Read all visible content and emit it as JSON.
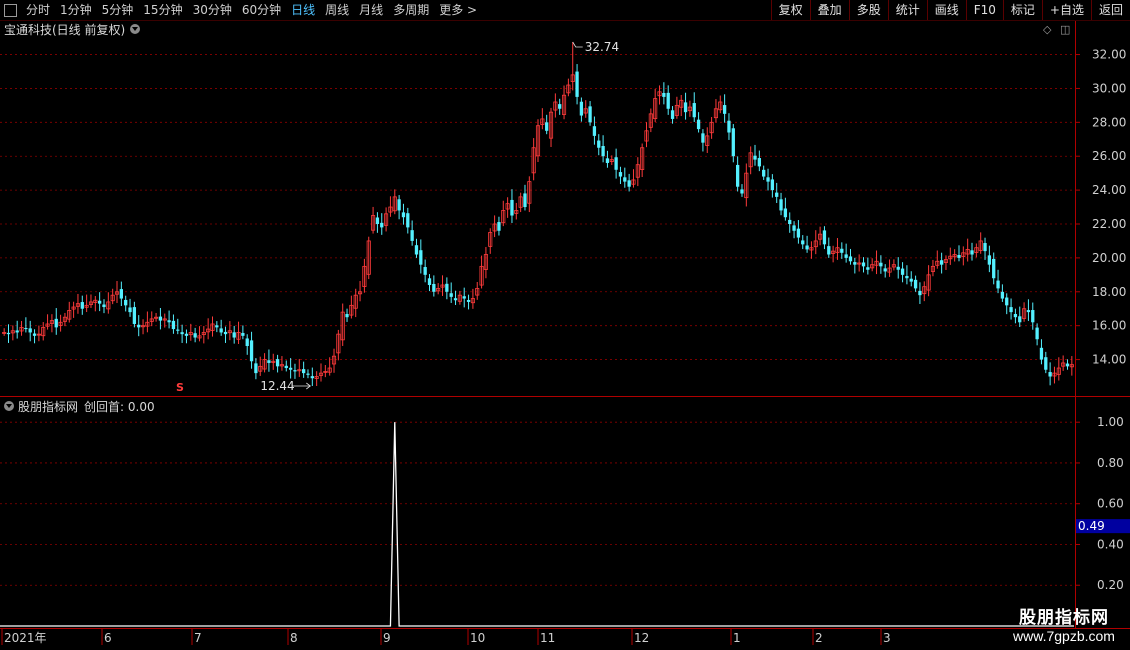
{
  "toolbar": {
    "periods": [
      "分时",
      "1分钟",
      "5分钟",
      "15分钟",
      "30分钟",
      "60分钟",
      "日线",
      "周线",
      "月线",
      "多周期",
      "更多 >"
    ],
    "active_period": "日线",
    "buttons": [
      "复权",
      "叠加",
      "多股",
      "统计",
      "画线",
      "F10",
      "标记",
      "+自选",
      "返回"
    ]
  },
  "main_panel": {
    "title": "宝通科技(日线 前复权)"
  },
  "sub_panel": {
    "indicator": "股朋指标网",
    "series_label": "创回首: 0.00"
  },
  "colors": {
    "up": "#ff3b3b",
    "down": "#54f0ff",
    "grid": "#8b0000",
    "signal": "#ffffff",
    "highlight": "#0000a0"
  },
  "logo": {
    "name": "股朋指标网",
    "url": "www.7gpzb.com"
  },
  "chart_data": [
    {
      "type": "candlestick",
      "ylim": [
        12.44,
        32.74
      ],
      "y_ticks": [
        "32.00",
        "30.00",
        "28.00",
        "26.00",
        "24.00",
        "22.00",
        "20.00",
        "18.00",
        "16.00",
        "14.00"
      ],
      "high_label": "32.74",
      "low_label": "12.44",
      "marker": "S",
      "x_labels": [
        "2021年",
        "6",
        "7",
        "8",
        "9",
        "10",
        "11",
        "12",
        "1",
        "2",
        "3"
      ],
      "series": [
        {
          "values": [
            15.6,
            15.5,
            15.7,
            15.6,
            15.9,
            15.8,
            15.6,
            15.4,
            15.5,
            15.9,
            16.1,
            16.3,
            15.9,
            16.2,
            16.5,
            16.9,
            17.1,
            17.3,
            17.0,
            17.2,
            17.4,
            17.5,
            17.3,
            17.1,
            17.4,
            17.8,
            18.0,
            17.6,
            17.2,
            16.8,
            16.1,
            15.9,
            16.0,
            16.2,
            16.4,
            16.5,
            16.3,
            16.4,
            16.2,
            15.8,
            15.7,
            15.5,
            15.4,
            15.6,
            15.3,
            15.4,
            15.6,
            15.8,
            16.1,
            15.9,
            15.6,
            15.5,
            15.7,
            15.3,
            15.6,
            15.4,
            14.8,
            13.9,
            13.2,
            13.6,
            14.0,
            13.8,
            13.9,
            13.6,
            13.7,
            13.5,
            13.4,
            13.3,
            13.4,
            13.2,
            13.1,
            12.9,
            13.0,
            13.2,
            13.3,
            13.5,
            14.2,
            15.5,
            16.8,
            16.5,
            17.2,
            17.8,
            18.0,
            19.5,
            21.0,
            22.5,
            22.0,
            21.8,
            22.6,
            23.0,
            23.6,
            22.8,
            22.4,
            21.8,
            21.0,
            20.2,
            19.6,
            19.0,
            18.4,
            18.0,
            18.2,
            18.4,
            18.0,
            17.7,
            17.5,
            17.8,
            17.6,
            17.4,
            17.6,
            18.2,
            19.5,
            20.2,
            21.5,
            22.0,
            21.6,
            22.8,
            23.2,
            22.5,
            22.8,
            23.6,
            23.0,
            24.5,
            26.5,
            27.8,
            28.2,
            27.5,
            28.6,
            29.2,
            28.8,
            29.6,
            30.2,
            30.8,
            29.5,
            28.4,
            28.8,
            28.0,
            27.2,
            26.5,
            26.0,
            25.6,
            25.8,
            25.2,
            24.8,
            24.5,
            24.2,
            24.6,
            25.5,
            26.5,
            27.5,
            28.5,
            29.4,
            29.8,
            29.5,
            28.8,
            28.2,
            29.0,
            29.3,
            28.6,
            28.9,
            28.3,
            27.6,
            26.8,
            27.2,
            28.0,
            28.8,
            29.2,
            28.5,
            27.4,
            26.0,
            24.2,
            23.8,
            25.0,
            26.2,
            25.8,
            25.4,
            24.8,
            24.5,
            24.0,
            23.6,
            22.8,
            22.4,
            22.0,
            21.6,
            21.2,
            20.8,
            20.5,
            20.6,
            21.0,
            21.4,
            20.8,
            20.2,
            20.4,
            20.6,
            20.3,
            20.0,
            19.8,
            19.6,
            19.7,
            19.5,
            19.3,
            19.6,
            19.8,
            19.5,
            19.2,
            19.4,
            19.6,
            19.3,
            19.0,
            18.8,
            18.6,
            18.2,
            17.8,
            18.3,
            19.0,
            19.5,
            19.8,
            19.6,
            19.9,
            20.1,
            20.2,
            20.0,
            20.3,
            20.5,
            20.2,
            20.6,
            21.0,
            20.4,
            19.6,
            18.8,
            18.2,
            17.6,
            17.2,
            16.8,
            16.5,
            16.2,
            17.0,
            16.8,
            16.2,
            15.2,
            14.0,
            13.4,
            13.0,
            13.2,
            13.5,
            13.8,
            13.6,
            13.7
          ]
        }
      ]
    },
    {
      "type": "line",
      "name": "创回首",
      "ylim": [
        0.0,
        1.05
      ],
      "y_ticks": [
        "1.00",
        "0.80",
        "0.60",
        "0.40",
        "0.20"
      ],
      "current_value": "0.49",
      "spike_index": 90,
      "spike_value": 1.0
    }
  ]
}
